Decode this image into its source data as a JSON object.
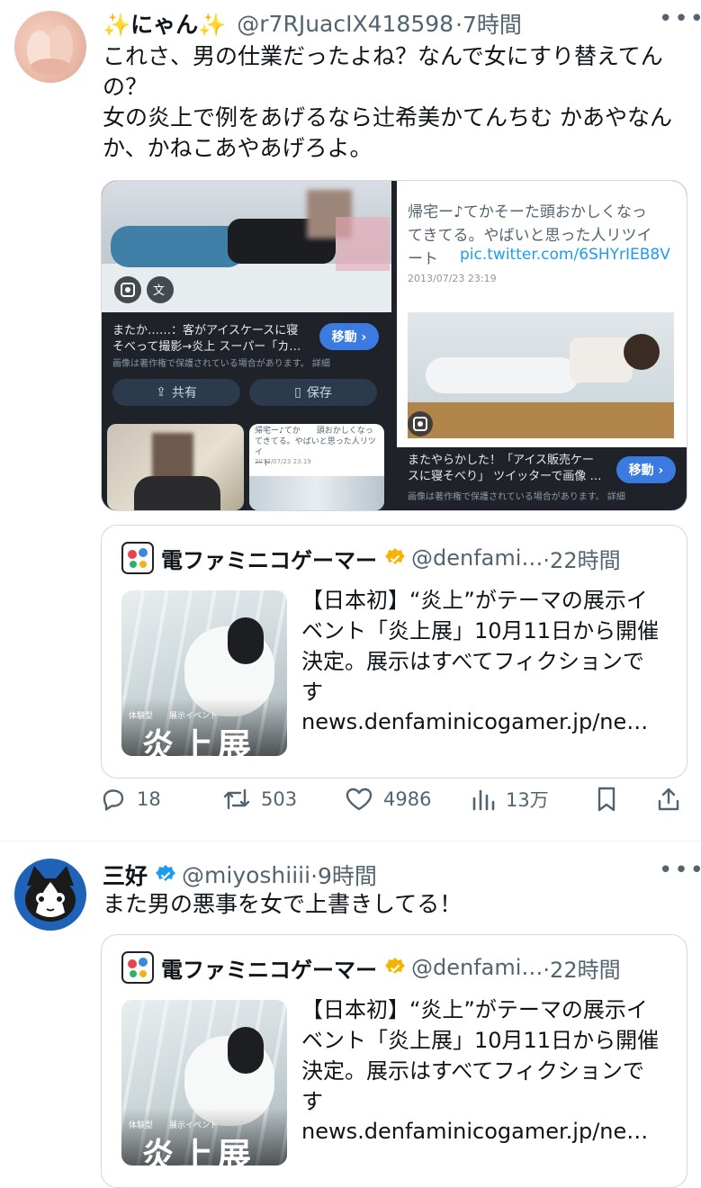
{
  "post1": {
    "display_name": "✨にゃん✨",
    "handle": "@r7RJuacIX418598",
    "time": "·7時間",
    "more": "•••",
    "text": "これさ、男の仕業だったよね？なんで女にすり替えてんの？\n女の炎上で例をあげるなら辻希美かてんちむ かあやなんか、かねこあやあげろよ。",
    "media_left": {
      "caption": "またか……：客がアイスケースに寝\nそべって撮影→炎上 スーパー「カ…",
      "copyright": "画像は著作権で保護されている場合があります。 詳細",
      "go": "移動 ›",
      "share": "共有",
      "save": "保存",
      "mini_text": "帰宅ー♪てか　　頭おかしくなっ\nてきてる。やばいと思った人リツイ\nート",
      "mini_date": "2013/07/23 23:19"
    },
    "media_right": {
      "tweet_text": "帰宅ー♪てかそーた頭おかしくなっ\nてきてる。やばいと思った人リツイ\nート",
      "tweet_link": "pic.twitter.com/6SHYrIEB8V",
      "tweet_date": "2013/07/23 23:19",
      "caption": "またやらかした！「アイス販売ケー\nスに寝そべり」 ツイッターで画像 …",
      "copyright": "画像は著作権で保護されている場合があります。 詳細",
      "go": "移動 ›"
    },
    "quote": {
      "name": "電ファミニコゲーマー",
      "handle": "@denfami…",
      "time": "·22時間",
      "text": "【日本初】“炎上”がテーマの展示イベント「炎上展」10月11日から開催決定。展示はすべてフィクションです",
      "url": "news.denfaminicogamer.jp/ne…",
      "thumb_title": "炎上展",
      "thumb_sub": "体験型　　展示イベント"
    },
    "actions": {
      "replies": "18",
      "retweets": "503",
      "likes": "4986",
      "views": "13万"
    }
  },
  "post2": {
    "display_name": "三好",
    "handle": "@miyoshiiii",
    "time": "·9時間",
    "more": "•••",
    "text": "また男の悪事を女で上書きしてる！",
    "quote": {
      "name": "電ファミニコゲーマー",
      "handle": "@denfami…",
      "time": "·22時間",
      "text": "【日本初】“炎上”がテーマの展示イベント「炎上展」10月11日から開催決定。展示はすべてフィクションです",
      "url": "news.denfaminicogamer.jp/ne…",
      "thumb_title": "炎上展",
      "thumb_sub": "体験型　　展示イベント"
    }
  },
  "colors": {
    "verified": "#f4b400",
    "verified_blue": "#1d9bf0",
    "secondary": "#536471",
    "border": "#cfd9de"
  }
}
